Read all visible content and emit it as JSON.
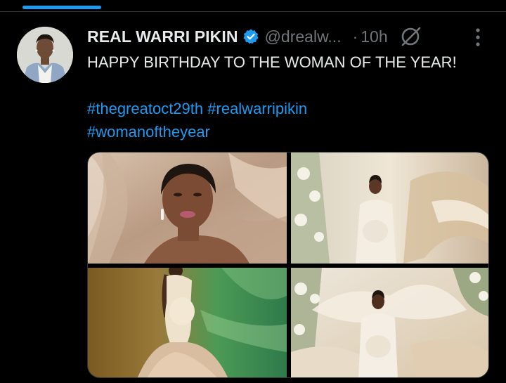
{
  "tweet": {
    "display_name": "REAL WARRI PIKIN",
    "handle": "@drealw...",
    "separator": "·",
    "timestamp": "10h",
    "text": "HAPPY BIRTHDAY TO THE WOMAN OF THE YEAR!",
    "hashtags": [
      "#thegreatoct29th",
      "#realwarripikin",
      "#womanoftheyear"
    ]
  },
  "icons": {
    "verified": "verified-badge-icon",
    "grok": "grok-icon",
    "more": "more-options-icon"
  },
  "colors": {
    "accent": "#1d9bf0",
    "text_primary": "#e7e9ea",
    "text_secondary": "#71767b",
    "background": "#000000"
  }
}
